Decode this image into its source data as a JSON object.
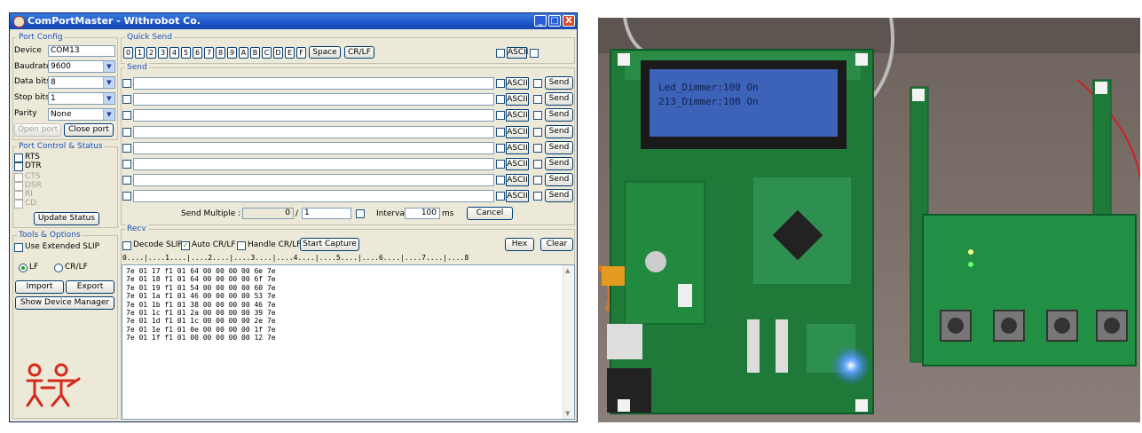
{
  "window": {
    "title": "ComPortMaster - Withrobot Co.",
    "min_label": "_",
    "max_label": "□",
    "close_label": "X"
  },
  "port_config": {
    "group_label": "Port Config",
    "device_label": "Device",
    "device_value": "COM13",
    "baudrate_label": "Baudrate",
    "baudrate_value": "9600",
    "databits_label": "Data bits",
    "databits_value": "8",
    "stopbits_label": "Stop bits",
    "stopbits_value": "1",
    "parity_label": "Parity",
    "parity_value": "None",
    "open_port": "Open port",
    "close_port": "Close port"
  },
  "port_control": {
    "group_label": "Port Control & Status",
    "rts": "RTS",
    "dtr": "DTR",
    "cts": "CTS",
    "dsr": "DSR",
    "ri": "RI",
    "cd": "CD",
    "update_status": "Update Status"
  },
  "tools": {
    "group_label": "Tools & Options",
    "extended_slip": "Use Extended SLIP",
    "lf": "LF",
    "crlf": "CR/LF",
    "import": "Import",
    "export": "Export",
    "device_manager": "Show Device Manager"
  },
  "quick_send": {
    "group_label": "Quick Send",
    "keys": [
      "0",
      "1",
      "2",
      "3",
      "4",
      "5",
      "6",
      "7",
      "8",
      "9",
      "A",
      "B",
      "C",
      "D",
      "E",
      "F"
    ],
    "space": "Space",
    "crlf": "CR/LF",
    "ascii": "ASCII"
  },
  "send": {
    "group_label": "Send",
    "ascii": "ASCII",
    "send_button": "Send",
    "rows": [
      "",
      "",
      "",
      "",
      "",
      "",
      "",
      ""
    ],
    "multiple_label": "Send Multiple :",
    "multiple_count": "0",
    "slash": "/",
    "multiple_total": "1",
    "interval_label": "Interval",
    "interval_value": "100",
    "interval_unit": "ms",
    "cancel": "Cancel"
  },
  "recv": {
    "group_label": "Recv",
    "decode_slip": "Decode SLIP",
    "auto_crlf": "Auto CR/LF",
    "handle_crlf": "Handle CR/LF",
    "start_capture": "Start Capture",
    "hex": "Hex",
    "clear": "Clear",
    "ruler": "0....|....1....|....2....|....3....|....4....|....5....|....6....|....7....|....8",
    "lines": [
      "7e 01 17 f1 01 64 00 00 00 00 6e 7e",
      "7e 01 18 f1 01 64 00 00 00 00 6f 7e",
      "7e 01 19 f1 01 54 00 00 00 00 60 7e",
      "7e 01 1a f1 01 46 00 00 00 00 53 7e",
      "7e 01 1b f1 01 38 00 00 00 00 46 7e",
      "7e 01 1c f1 01 2a 00 00 00 00 39 7e",
      "7e 01 1d f1 01 1c 00 00 00 00 2e 7e",
      "7e 01 1e f1 01 0e 00 00 00 00 1f 7e",
      "7e 01 1f f1 01 00 00 00 00 00 12 7e"
    ]
  },
  "photo": {
    "lcd_line1": "Led_Dimmer:100  On",
    "lcd_line2": "213_Dimmer:100  On"
  }
}
